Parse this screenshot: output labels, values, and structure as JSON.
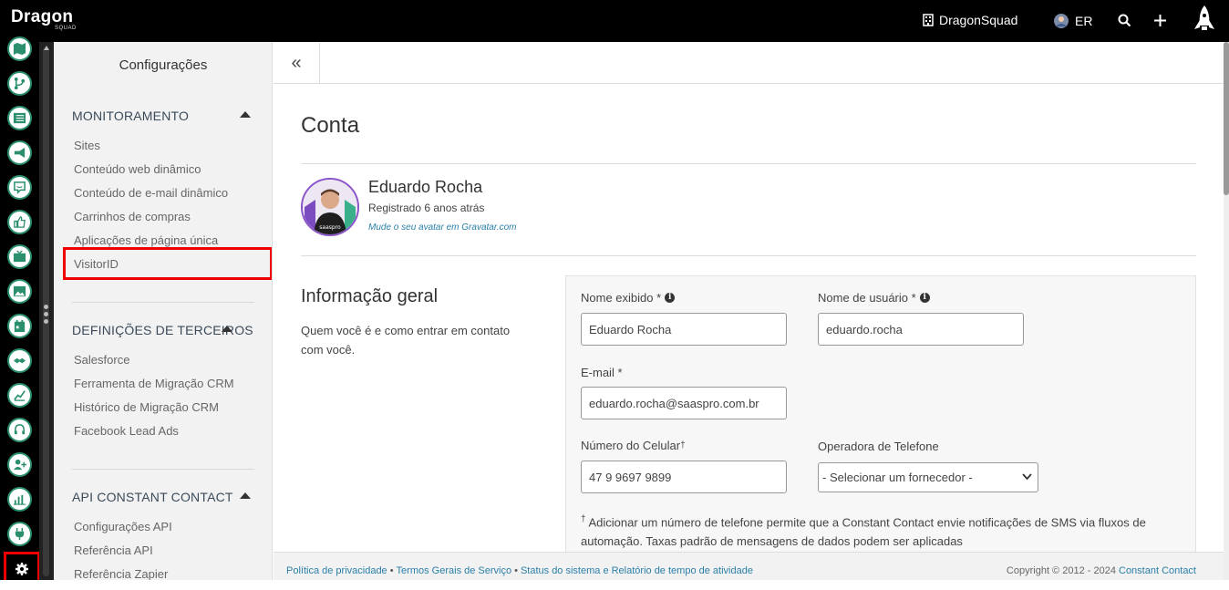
{
  "topbar": {
    "logo": "Dragon",
    "logo_sub": "SQUAD",
    "org": "DragonSquad",
    "user_initials": "ER"
  },
  "sidebar": {
    "title": "Configurações",
    "sections": [
      {
        "heading": "MONITORAMENTO",
        "items": [
          "Sites",
          "Conteúdo web dinâmico",
          "Conteúdo de e-mail dinâmico",
          "Carrinhos de compras",
          "Aplicações de página única",
          "VisitorID"
        ]
      },
      {
        "heading": "DEFINIÇÕES DE TERCEIROS",
        "items": [
          "Salesforce",
          "Ferramenta de Migração CRM",
          "Histórico de Migração CRM",
          "Facebook Lead Ads"
        ]
      },
      {
        "heading": "API CONSTANT CONTACT",
        "items": [
          "Configurações API",
          "Referência API",
          "Referência Zapier"
        ]
      }
    ]
  },
  "collapse_label": "«",
  "main": {
    "title": "Conta",
    "user": {
      "name": "Eduardo Rocha",
      "registered": "Registrado 6 anos atrás",
      "gravatar_link": "Mude o seu avatar em Gravatar.com",
      "avatar_text": "saaspro"
    },
    "general": {
      "title": "Informação geral",
      "description": "Quem você é e como entrar em contato com você."
    },
    "form": {
      "display_name_label": "Nome exibido *",
      "display_name_value": "Eduardo Rocha",
      "username_label": "Nome de usuário *",
      "username_value": "eduardo.rocha",
      "email_label": "E-mail *",
      "email_value": "eduardo.rocha@saaspro.com.br",
      "phone_label": "Número do Celular",
      "phone_sup": "†",
      "phone_value": "47 9 9697 9899",
      "carrier_label": "Operadora de Telefone",
      "carrier_value": "- Selecionar um fornecedor -",
      "note_sup": "†",
      "note": "Adicionar um número de telefone permite que a Constant Contact envie notificações de SMS via fluxos de automação. Taxas padrão de mensagens de dados podem ser aplicadas"
    }
  },
  "footer": {
    "links": [
      "Política de privacidade",
      "Termos Gerais de Serviço",
      "Status do sistema e Relatório de tempo de atividade"
    ],
    "separator": "•",
    "copyright": "Copyright © 2012 - 2024",
    "copyright_link": "Constant Contact"
  },
  "colors": {
    "accent_green": "#2b8f6e",
    "link_blue": "#2a7fa8",
    "highlight_red": "#e00000"
  }
}
